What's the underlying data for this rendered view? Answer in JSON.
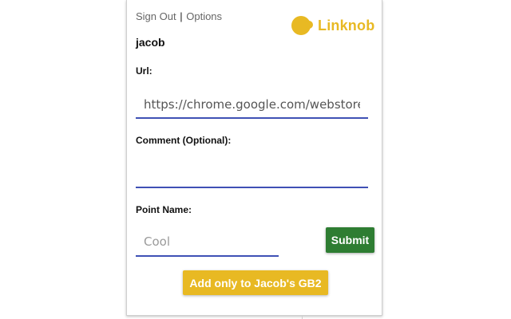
{
  "header": {
    "sign_out_label": "Sign Out",
    "separator": "|",
    "options_label": "Options",
    "logo_text": "Linknob",
    "logo_icon": "linknob-logo-icon"
  },
  "user": {
    "name": "jacob"
  },
  "form": {
    "url": {
      "label": "Url:",
      "value": "https://chrome.google.com/webstore"
    },
    "comment": {
      "label": "Comment (Optional):",
      "value": ""
    },
    "point": {
      "label": "Point Name:",
      "placeholder": "Cool"
    },
    "submit_label": "Submit",
    "add_only_label": "Add only to Jacob's GB2"
  },
  "colors": {
    "accent": "#e8b923",
    "underline": "#3f51b5",
    "submit": "#2e7d32"
  }
}
